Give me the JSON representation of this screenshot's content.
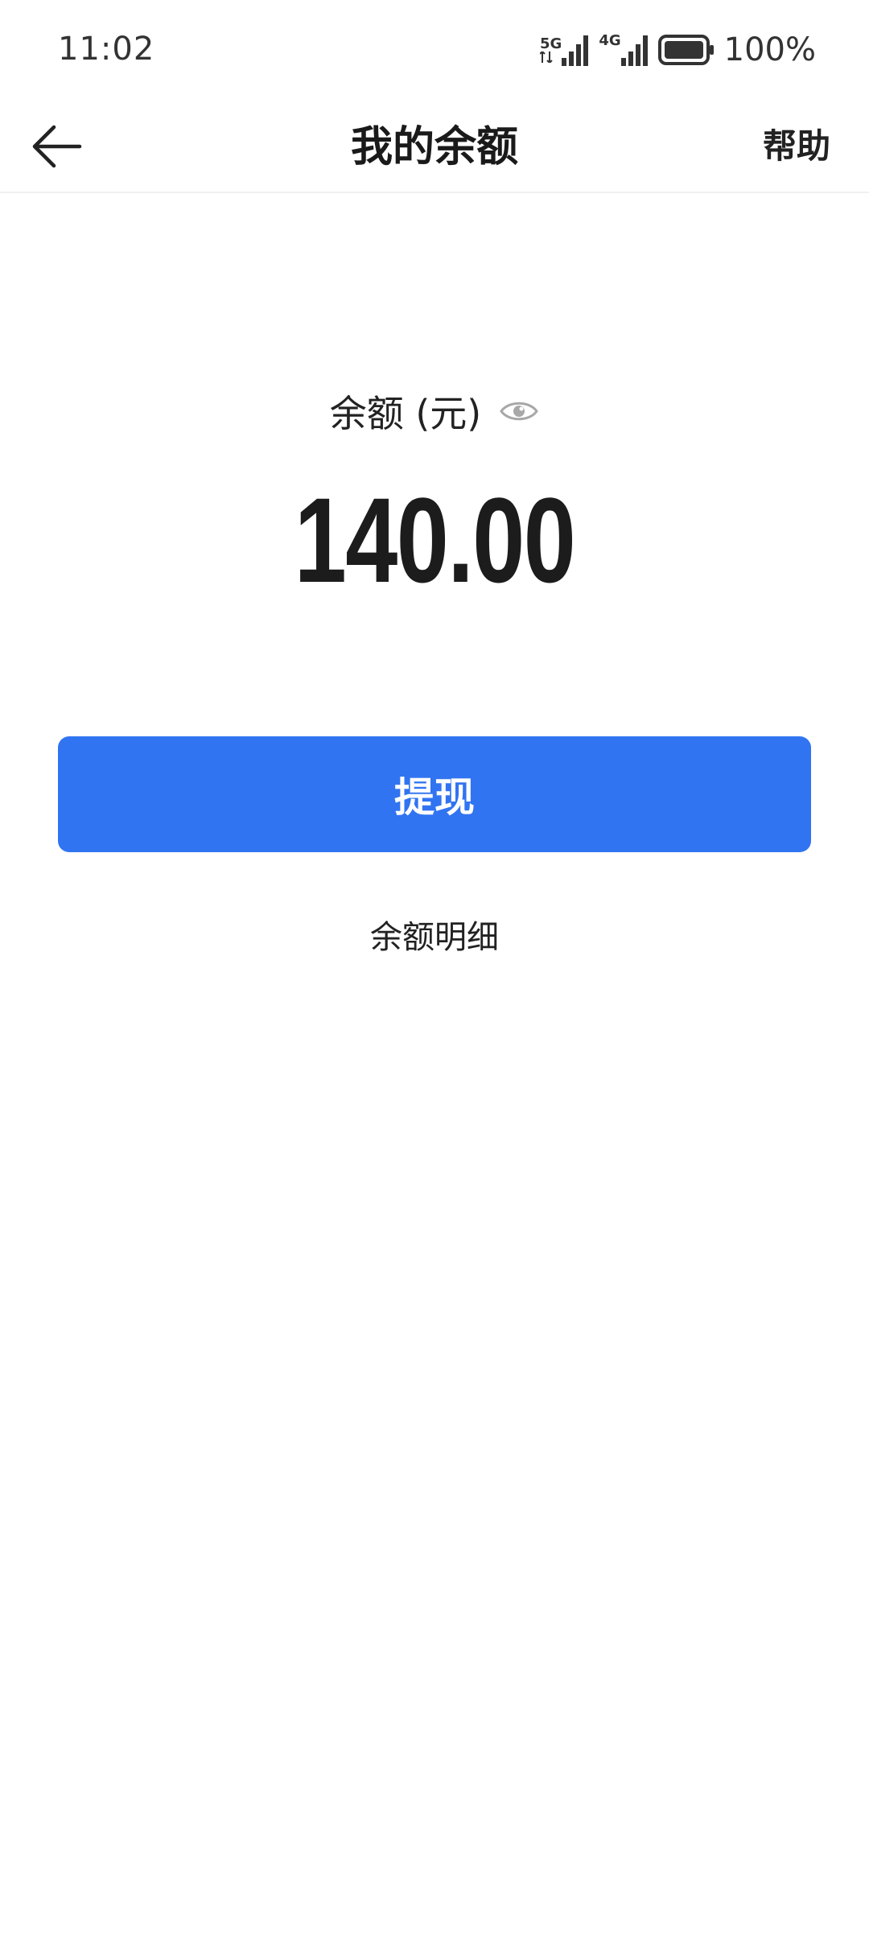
{
  "status_bar": {
    "time": "11:02",
    "net1": "5G",
    "net2": "4G",
    "battery_percent": "100%",
    "icons": [
      "signal-5g-icon",
      "signal-4g-icon",
      "battery-icon"
    ]
  },
  "nav": {
    "title": "我的余额",
    "help_label": "帮助",
    "back_icon": "arrow-left-icon"
  },
  "balance": {
    "label": "余额 (元)",
    "amount": "140.00",
    "eye_icon": "eye-icon"
  },
  "actions": {
    "withdraw_label": "提现",
    "detail_label": "余额明细"
  },
  "colors": {
    "primary": "#3174f1",
    "text": "#1f1f1f",
    "icon_gray": "#a8a8a8"
  }
}
